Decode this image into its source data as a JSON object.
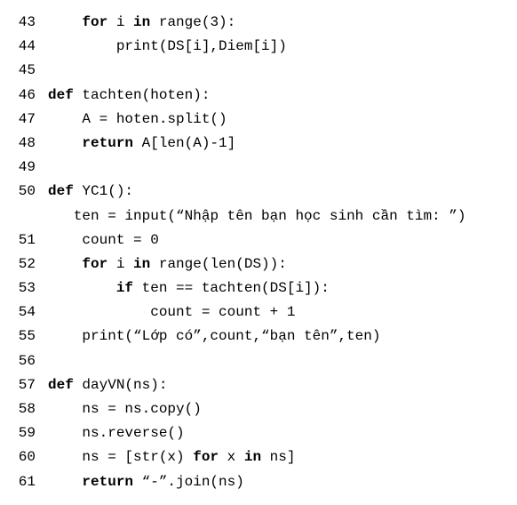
{
  "code_lines": [
    {
      "num": "43",
      "indent": "    ",
      "segments": [
        {
          "t": "for",
          "k": true
        },
        {
          "t": " i "
        },
        {
          "t": "in",
          "k": true
        },
        {
          "t": " range(3):"
        }
      ]
    },
    {
      "num": "44",
      "indent": "        ",
      "segments": [
        {
          "t": "print(DS[i],Diem[i])"
        }
      ]
    },
    {
      "num": "45",
      "indent": "",
      "segments": []
    },
    {
      "num": "46",
      "indent": "",
      "segments": [
        {
          "t": "def",
          "k": true
        },
        {
          "t": " tachten(hoten):"
        }
      ]
    },
    {
      "num": "47",
      "indent": "    ",
      "segments": [
        {
          "t": "A = hoten.split()"
        }
      ]
    },
    {
      "num": "48",
      "indent": "    ",
      "segments": [
        {
          "t": "return",
          "k": true
        },
        {
          "t": " A[len(A)-1]"
        }
      ]
    },
    {
      "num": "49",
      "indent": "",
      "segments": []
    },
    {
      "num": "50",
      "indent": "",
      "segments": [
        {
          "t": "def",
          "k": true
        },
        {
          "t": " YC1():"
        }
      ]
    },
    {
      "num": "",
      "indent": "   ",
      "segments": [
        {
          "t": "ten = input(“Nhập tên bạn học sinh cần tìm: ”)"
        }
      ]
    },
    {
      "num": "51",
      "indent": "    ",
      "segments": [
        {
          "t": "count = 0"
        }
      ]
    },
    {
      "num": "52",
      "indent": "    ",
      "segments": [
        {
          "t": "for",
          "k": true
        },
        {
          "t": " i "
        },
        {
          "t": "in",
          "k": true
        },
        {
          "t": " range(len(DS)):"
        }
      ]
    },
    {
      "num": "53",
      "indent": "        ",
      "segments": [
        {
          "t": "if",
          "k": true
        },
        {
          "t": " ten == tachten(DS[i]):"
        }
      ]
    },
    {
      "num": "54",
      "indent": "            ",
      "segments": [
        {
          "t": "count = count + 1"
        }
      ]
    },
    {
      "num": "55",
      "indent": "    ",
      "segments": [
        {
          "t": "print(“Lớp có”,count,“bạn tên”,ten)"
        }
      ]
    },
    {
      "num": "56",
      "indent": "",
      "segments": []
    },
    {
      "num": "57",
      "indent": "",
      "segments": [
        {
          "t": "def",
          "k": true
        },
        {
          "t": " dayVN(ns):"
        }
      ]
    },
    {
      "num": "58",
      "indent": "    ",
      "segments": [
        {
          "t": "ns = ns.copy()"
        }
      ]
    },
    {
      "num": "59",
      "indent": "    ",
      "segments": [
        {
          "t": "ns.reverse()"
        }
      ]
    },
    {
      "num": "60",
      "indent": "    ",
      "segments": [
        {
          "t": "ns = [str(x) "
        },
        {
          "t": "for",
          "k": true
        },
        {
          "t": " x "
        },
        {
          "t": "in",
          "k": true
        },
        {
          "t": " ns]"
        }
      ]
    },
    {
      "num": "61",
      "indent": "    ",
      "segments": [
        {
          "t": "return",
          "k": true
        },
        {
          "t": " “-”.join(ns)"
        }
      ]
    }
  ]
}
